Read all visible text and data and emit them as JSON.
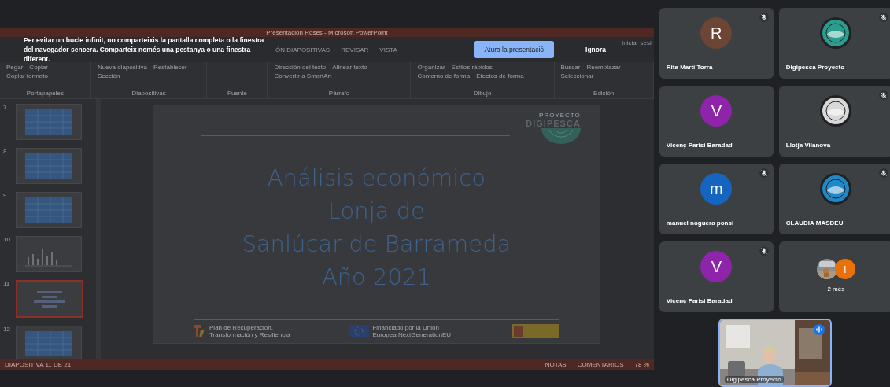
{
  "shared_screen": {
    "app_title": "Presentación Roses - Microsoft PowerPoint",
    "ribbon_tabs": [
      "ÓN DIAPOSITIVAS",
      "REVISAR",
      "VISTA"
    ],
    "account_link": "Iniciar sesi",
    "ribbon_groups": [
      {
        "label": "Portapapeles",
        "items": [
          "Pegar",
          "Copiar",
          "Copiar formato"
        ]
      },
      {
        "label": "Diapositivas",
        "items": [
          "Nueva diapositiva",
          "Restablecer",
          "Sección"
        ]
      },
      {
        "label": "Fuente"
      },
      {
        "label": "Párrafo",
        "items": [
          "Dirección del texto",
          "Alinear texto",
          "Convertir a SmartArt"
        ]
      },
      {
        "label": "Dibujo",
        "items": [
          "Organizar",
          "Estilos rápidos",
          "Contorno de forma",
          "Efectos de forma"
        ]
      },
      {
        "label": "Edición",
        "items": [
          "Buscar",
          "Reemplazar",
          "Seleccionar"
        ]
      }
    ],
    "slide_thumbnails": [
      {
        "number": "7",
        "kind": "table",
        "selected": false
      },
      {
        "number": "8",
        "kind": "table",
        "selected": false
      },
      {
        "number": "9",
        "kind": "table",
        "selected": false
      },
      {
        "number": "10",
        "kind": "chart",
        "selected": false
      },
      {
        "number": "11",
        "kind": "title",
        "selected": true
      },
      {
        "number": "12",
        "kind": "table",
        "selected": false
      }
    ],
    "slide": {
      "logo_caption": "PROYECTO",
      "logo_name": "DIGIPESCA",
      "title_lines": [
        "Análisis económico",
        "Lonja de",
        "Sanlúcar de Barrameda",
        "Año 2021"
      ],
      "footer_logos": [
        {
          "kind": "recovery",
          "text": "Plan de Recuperación, Transformación y Resiliencia"
        },
        {
          "kind": "eu",
          "text": "Financiado por la Unión Europea NextGenerationEU"
        },
        {
          "kind": "government"
        }
      ]
    },
    "status_bar": {
      "position": "DIAPOSITIVA 11 DE 21",
      "notes": "NOTAS",
      "comments": "COMENTARIOS",
      "zoom": "78 %"
    }
  },
  "share_warning": {
    "message": "Per evitar un bucle infinit, no comparteixis la pantalla completa o la finestra del navegador sencera. Comparteix només una pestanya o una finestra diferent.",
    "buttons": [
      {
        "label": "Atura la presentació",
        "kind": "primary"
      },
      {
        "label": "Ignora",
        "kind": "text"
      }
    ]
  },
  "participants": [
    {
      "name": "Rita Martí Torra",
      "kind": "letter",
      "initial": "R",
      "color": "#6d4535",
      "muted": true
    },
    {
      "name": "Digipesca Proyecto",
      "color": "#2a9d8f",
      "muted": true
    },
    {
      "name": "Vicenç Parisi Baradad",
      "kind": "letter",
      "initial": "V",
      "color": "#8e24aa",
      "muted": false
    },
    {
      "name": "Llotja Vilanova",
      "color": "#d8d8d8",
      "muted": true
    },
    {
      "name": "manuel noguera ponsi",
      "kind": "letter",
      "initial": "m",
      "color": "#1565c0",
      "muted": true
    },
    {
      "name": "CLAUDIA MASDEU",
      "color": "#1e88c8",
      "muted": true
    },
    {
      "name": "Vicenç Parisi Baradad",
      "kind": "letter",
      "initial": "V",
      "color": "#8e24aa",
      "muted": true
    }
  ],
  "more_tile": {
    "label": "2 més",
    "initial": "I",
    "color": "#e8710a"
  },
  "self_view": {
    "name": "Digipesca Proyecto",
    "speaking": true
  }
}
